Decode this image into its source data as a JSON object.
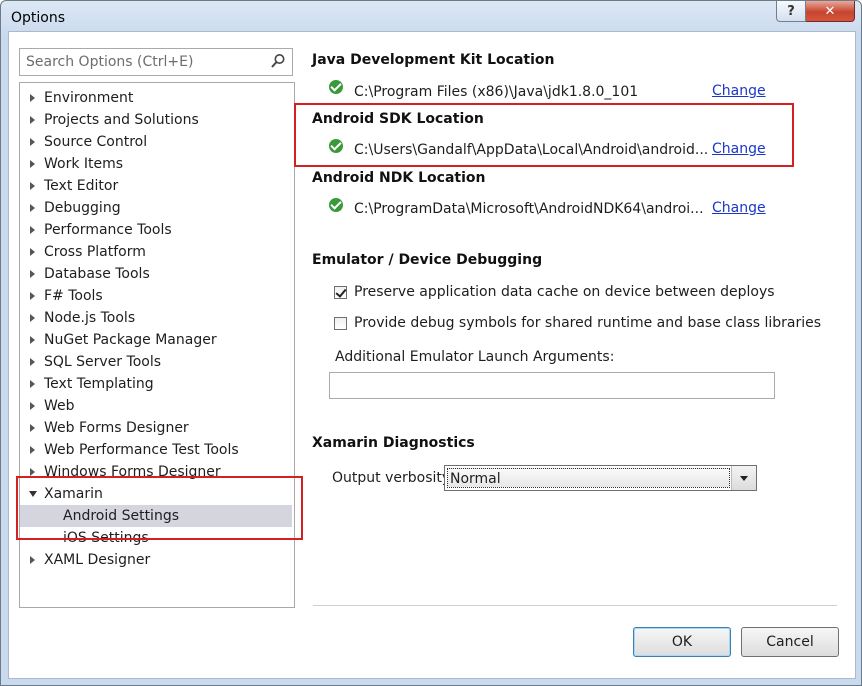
{
  "window": {
    "title": "Options",
    "help_label": "?",
    "close_label": "✕"
  },
  "search": {
    "placeholder": "Search Options (Ctrl+E)"
  },
  "tree": {
    "items": [
      {
        "label": "Environment"
      },
      {
        "label": "Projects and Solutions"
      },
      {
        "label": "Source Control"
      },
      {
        "label": "Work Items"
      },
      {
        "label": "Text Editor"
      },
      {
        "label": "Debugging"
      },
      {
        "label": "Performance Tools"
      },
      {
        "label": "Cross Platform"
      },
      {
        "label": "Database Tools"
      },
      {
        "label": "F# Tools"
      },
      {
        "label": "Node.js Tools"
      },
      {
        "label": "NuGet Package Manager"
      },
      {
        "label": "SQL Server Tools"
      },
      {
        "label": "Text Templating"
      },
      {
        "label": "Web"
      },
      {
        "label": "Web Forms Designer"
      },
      {
        "label": "Web Performance Test Tools"
      },
      {
        "label": "Windows Forms Designer"
      },
      {
        "label": "Xamarin"
      },
      {
        "label": "Android Settings"
      },
      {
        "label": "iOS Settings"
      },
      {
        "label": "XAML Designer"
      }
    ],
    "selected": "Android Settings"
  },
  "jdk": {
    "heading": "Java Development Kit Location",
    "path": "C:\\Program Files (x86)\\Java\\jdk1.8.0_101",
    "change": "Change"
  },
  "sdk": {
    "heading": "Android SDK Location",
    "path": "C:\\Users\\Gandalf\\AppData\\Local\\Android\\android...",
    "change": "Change"
  },
  "ndk": {
    "heading": "Android NDK Location",
    "path": "C:\\ProgramData\\Microsoft\\AndroidNDK64\\androi...",
    "change": "Change"
  },
  "emulator": {
    "heading": "Emulator / Device Debugging",
    "preserve_label": "Preserve application data cache on device between deploys",
    "preserve_checked": true,
    "debug_symbols_label": "Provide debug symbols for shared runtime and base class libraries",
    "debug_symbols_checked": false,
    "args_label": "Additional Emulator Launch Arguments:",
    "args_value": ""
  },
  "diagnostics": {
    "heading": "Xamarin Diagnostics",
    "verbosity_label": "Output verbosity:",
    "verbosity_value": "Normal"
  },
  "buttons": {
    "ok": "OK",
    "cancel": "Cancel"
  },
  "colors": {
    "highlight_box": "#d32020",
    "link": "#1a37c9",
    "ok_status": "#3a9a3a",
    "selection": "#d5d5e0"
  },
  "icons": {
    "search": "search-icon",
    "status": "check-circle-icon"
  }
}
